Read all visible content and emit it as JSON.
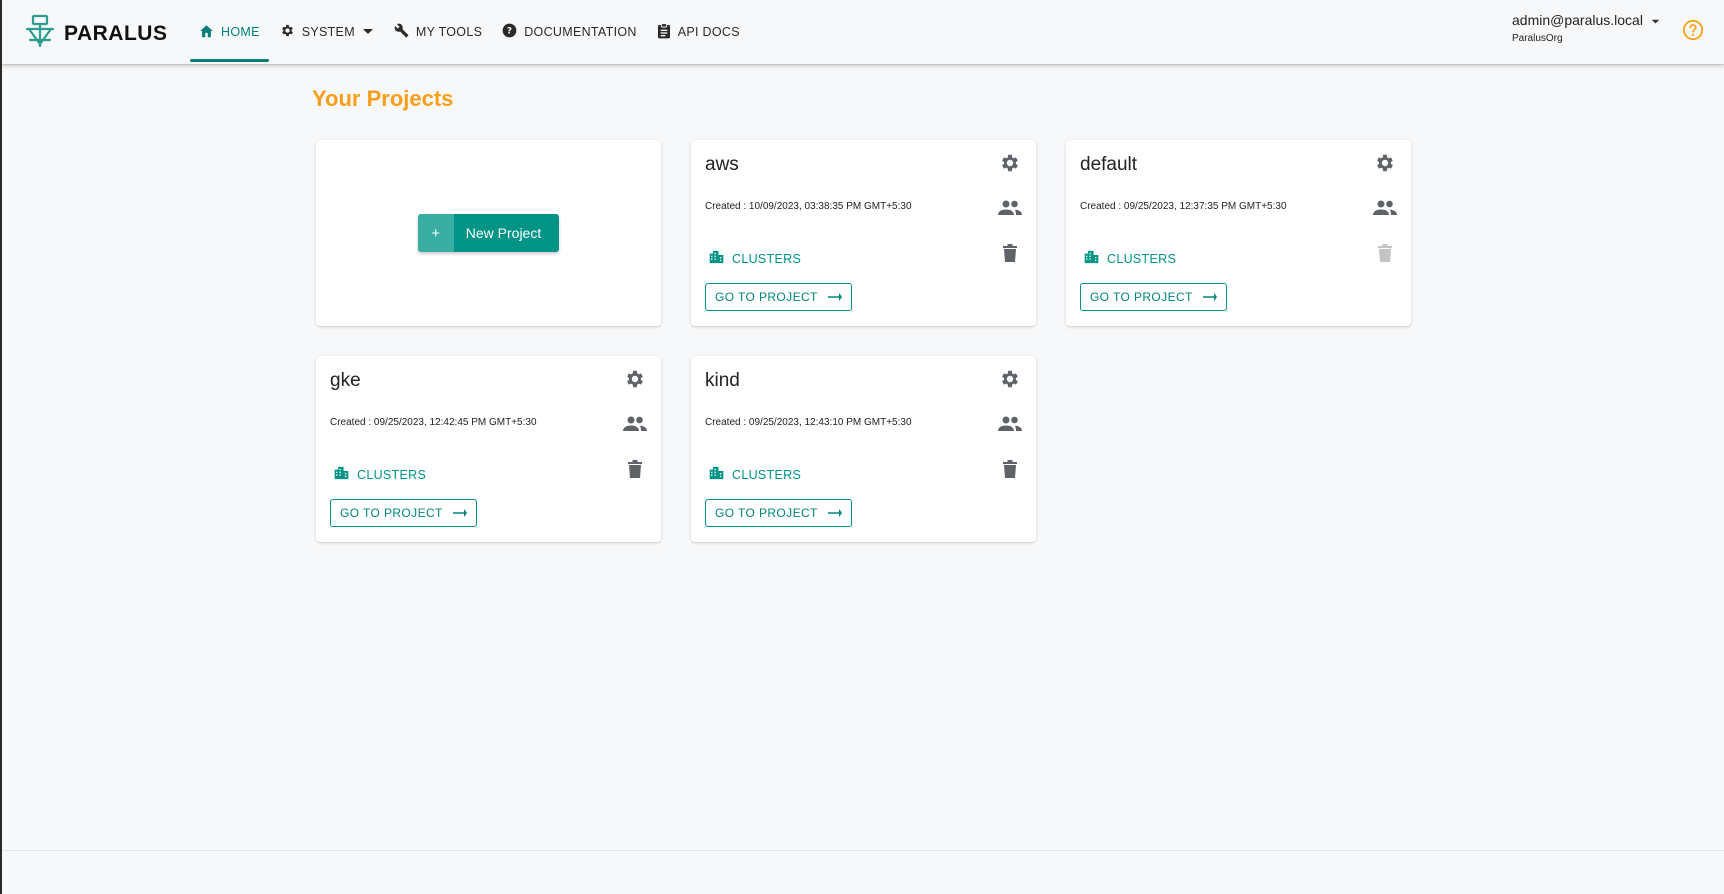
{
  "app": {
    "logo_text": "PARALUS"
  },
  "nav": {
    "items": [
      {
        "label": "HOME",
        "icon": "home-icon",
        "active": true
      },
      {
        "label": "SYSTEM",
        "icon": "gear-icon",
        "dropdown": true
      },
      {
        "label": "MY TOOLS",
        "icon": "wrench-icon"
      },
      {
        "label": "DOCUMENTATION",
        "icon": "help-circle-icon"
      },
      {
        "label": "API DOCS",
        "icon": "clipboard-icon"
      }
    ]
  },
  "user": {
    "email": "admin@paralus.local",
    "org": "ParalusOrg"
  },
  "page": {
    "title": "Your Projects",
    "new_project_plus": "+",
    "new_project_label": "New Project"
  },
  "projects": [
    {
      "name": "aws",
      "created": "Created : 10/09/2023, 03:38:35 PM GMT+5:30",
      "clusters_label": "CLUSTERS",
      "goto_label": "GO TO PROJECT",
      "delete_disabled": false
    },
    {
      "name": "default",
      "created": "Created : 09/25/2023, 12:37:35 PM GMT+5:30",
      "clusters_label": "CLUSTERS",
      "goto_label": "GO TO PROJECT",
      "delete_disabled": true
    },
    {
      "name": "gke",
      "created": "Created : 09/25/2023, 12:42:45 PM GMT+5:30",
      "clusters_label": "CLUSTERS",
      "goto_label": "GO TO PROJECT",
      "delete_disabled": false
    },
    {
      "name": "kind",
      "created": "Created : 09/25/2023, 12:43:10 PM GMT+5:30",
      "clusters_label": "CLUSTERS",
      "goto_label": "GO TO PROJECT",
      "delete_disabled": false
    }
  ],
  "colors": {
    "accent": "#009487",
    "title": "#f79e1b",
    "icon": "#5f6368",
    "disabled_icon": "#bdbdbd"
  }
}
